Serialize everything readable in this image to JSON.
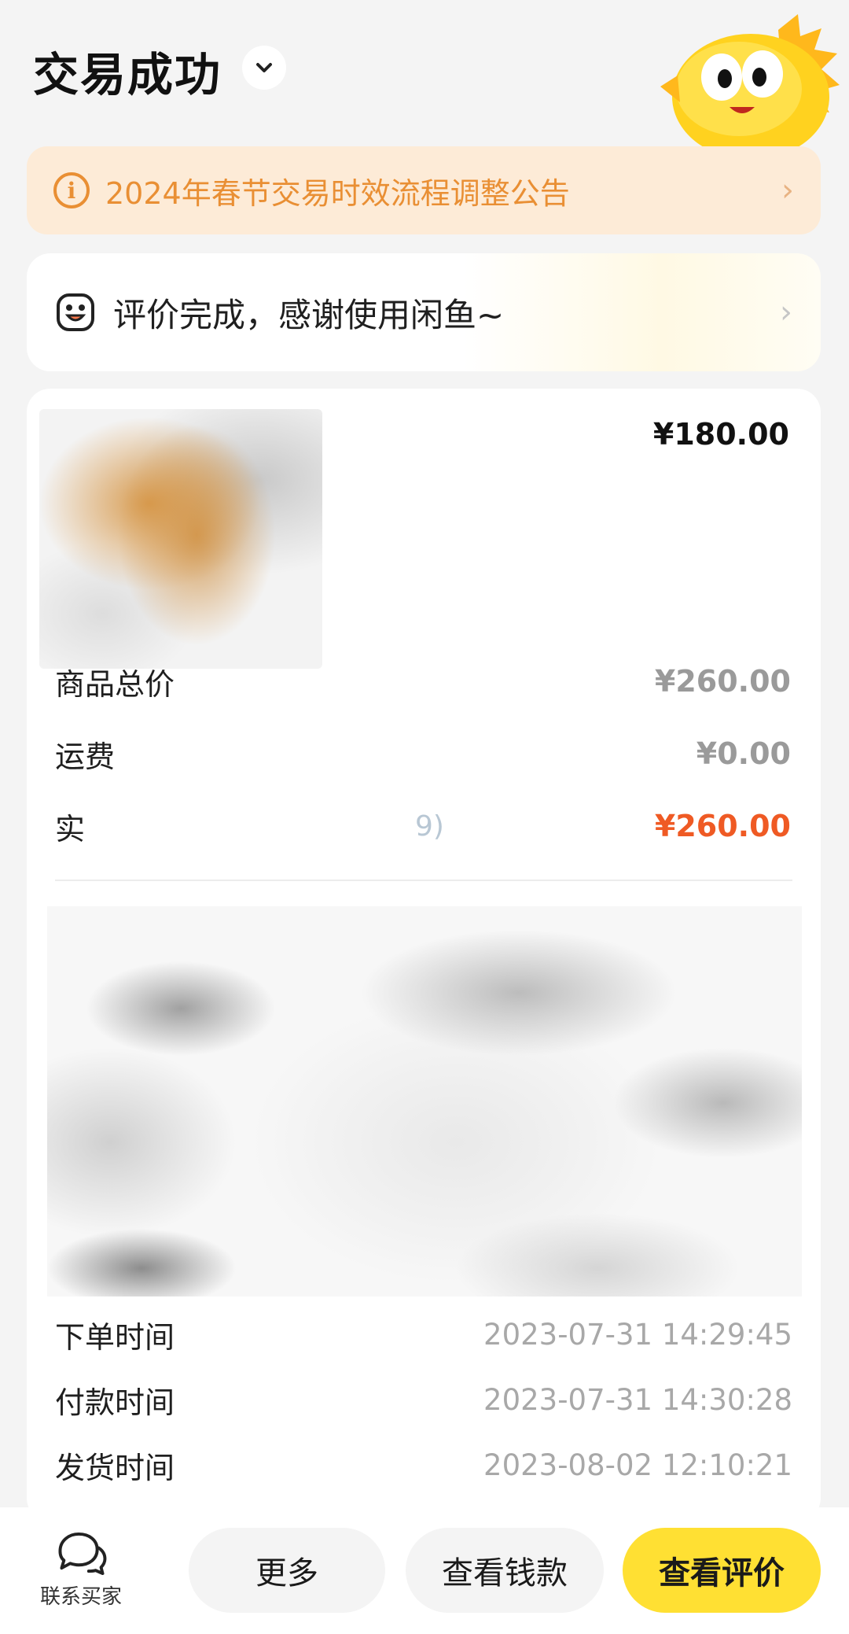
{
  "header": {
    "title": "交易成功",
    "dropdown_icon": "chevron-down-icon",
    "mascot": "fish-mascot"
  },
  "notice": {
    "icon": "info-icon",
    "text": "2024年春节交易时效流程调整公告",
    "arrow": "›",
    "color": "#e98f34"
  },
  "review": {
    "icon": "smile-face-icon",
    "text": "评价完成，感谢使用闲鱼~",
    "arrow": "›"
  },
  "order": {
    "item_price": "¥180.00",
    "rows": {
      "total_label": "商品总价",
      "total_value": "¥260.00",
      "shipping_label": "运费",
      "shipping_value": "¥0.00",
      "paid_label": "实",
      "paid_note": "9)",
      "paid_value": "¥260.00"
    },
    "times": [
      {
        "label": "下单时间",
        "value": "2023-07-31 14:29:45"
      },
      {
        "label": "付款时间",
        "value": "2023-07-31 14:30:28"
      },
      {
        "label": "发货时间",
        "value": "2023-08-02 12:10:21"
      }
    ]
  },
  "bottom": {
    "contact_label": "联系买家",
    "contact_icon": "chat-bubbles-icon",
    "more": "更多",
    "view_money": "查看钱款",
    "view_review": "查看评价",
    "accent": "#ffe033"
  }
}
